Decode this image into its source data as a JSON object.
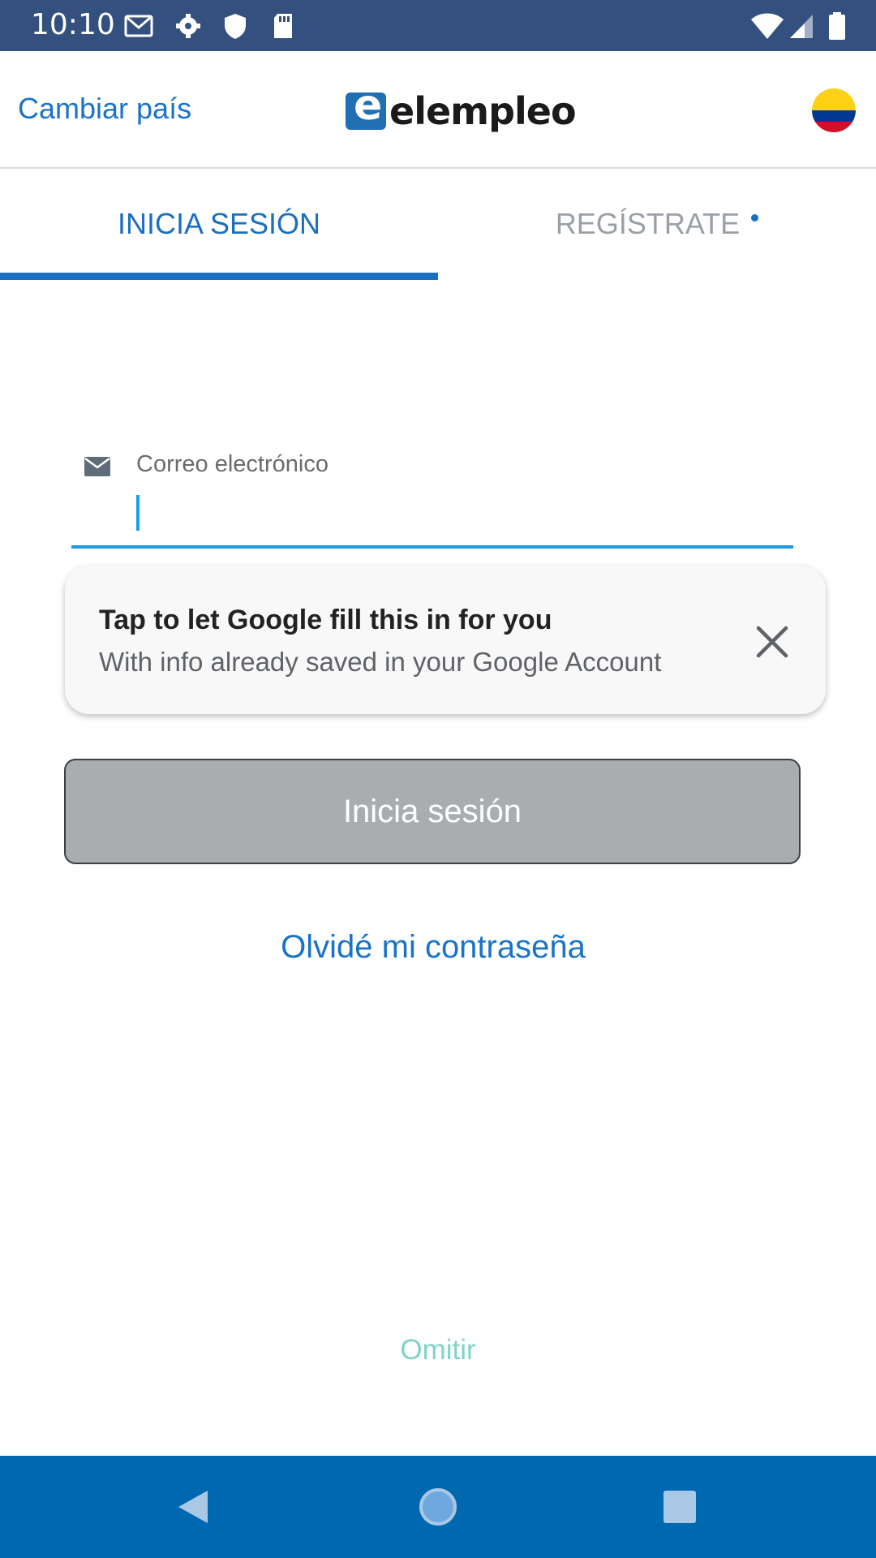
{
  "status_bar": {
    "time": "10:10",
    "icons": [
      "gmail-icon",
      "settings-icon",
      "shield-icon",
      "sd-card-icon",
      "wifi-icon",
      "signal-icon",
      "battery-icon"
    ]
  },
  "header": {
    "change_country": "Cambiar país",
    "logo_mark": "e",
    "logo_text": "elempleo",
    "flag": "colombia-flag",
    "flag_colors": [
      "#fcd116",
      "#003893",
      "#ce1126"
    ]
  },
  "tabs": {
    "login": "INICIA SESIÓN",
    "register": "REGÍSTRATE",
    "active": "login"
  },
  "email_field": {
    "label": "Correo electrónico",
    "value": "",
    "icon": "envelope-icon"
  },
  "autofill": {
    "title": "Tap to let Google fill this in for you",
    "subtitle": "With info already saved in your Google Account",
    "close_icon": "close-icon"
  },
  "login_button": "Inicia sesión",
  "forgot_password": "Olvidé mi contraseña",
  "skip": "Omitir",
  "nav": [
    "back-icon",
    "home-icon",
    "recents-icon"
  ],
  "colors": {
    "status_bar": "#34507e",
    "accent": "#1a6fc0",
    "nav_bar": "#0067b1",
    "button_disabled": "#a9adb0",
    "skip": "#7fd3c8"
  }
}
